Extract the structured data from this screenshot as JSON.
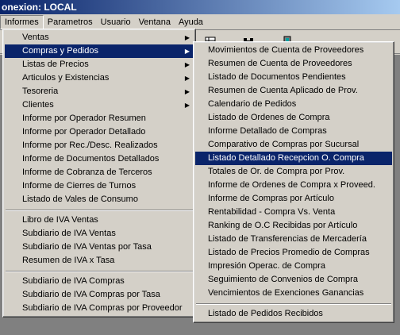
{
  "window": {
    "title": "onexion: LOCAL"
  },
  "menubar": {
    "items": [
      "Informes",
      "Parametros",
      "Usuario",
      "Ventana",
      "Ayuda"
    ]
  },
  "toolbar": {
    "icons": [
      "grid-icon",
      "binoculars-icon",
      "door-exit-icon"
    ]
  },
  "informes_menu": {
    "group1": [
      {
        "label": "Ventas",
        "submenu": true
      },
      {
        "label": "Compras y Pedidos",
        "submenu": true,
        "highlighted": true
      },
      {
        "label": "Listas de Precios",
        "submenu": true
      },
      {
        "label": "Articulos y Existencias",
        "submenu": true
      },
      {
        "label": "Tesoreria",
        "submenu": true
      },
      {
        "label": "Clientes",
        "submenu": true
      },
      {
        "label": "Informe por Operador Resumen"
      },
      {
        "label": "Informe por Operador Detallado"
      },
      {
        "label": "Informe por Rec./Desc. Realizados"
      },
      {
        "label": "Informe de Documentos Detallados"
      },
      {
        "label": "Informe de Cobranza de Terceros"
      },
      {
        "label": "Informe de Cierres de Turnos"
      },
      {
        "label": "Listado de Vales de Consumo"
      }
    ],
    "group2": [
      {
        "label": "Libro de IVA Ventas"
      },
      {
        "label": "Subdiario de IVA Ventas"
      },
      {
        "label": "Subdiario de IVA Ventas por Tasa"
      },
      {
        "label": "Resumen de IVA x Tasa"
      }
    ],
    "group3": [
      {
        "label": "Subdiario de IVA Compras"
      },
      {
        "label": "Subdiario de IVA Compras por Tasa"
      },
      {
        "label": "Subdiario de IVA Compras por Proveedor"
      }
    ]
  },
  "compras_menu": {
    "items": [
      {
        "label": "Movimientos de Cuenta de Proveedores"
      },
      {
        "label": "Resumen de Cuenta de Proveedores"
      },
      {
        "label": "Listado de Documentos Pendientes"
      },
      {
        "label": "Resumen de Cuenta Aplicado de Prov."
      },
      {
        "label": "Calendario de Pedidos"
      },
      {
        "label": "Listado de Ordenes de Compra"
      },
      {
        "label": "Informe Detallado de Compras"
      },
      {
        "label": "Comparativo de Compras por Sucursal"
      },
      {
        "label": "Listado Detallado Recepcion O. Compra",
        "highlighted": true
      },
      {
        "label": "Totales de Or. de Compra por Prov."
      },
      {
        "label": "Informe de Ordenes de Compra x Proveed."
      },
      {
        "label": "Informe de Compras por Artículo"
      },
      {
        "label": "Rentabilidad - Compra Vs. Venta"
      },
      {
        "label": "Ranking de O.C Recibidas por Artículo"
      },
      {
        "label": "Listado de Transferencias de Mercadería"
      },
      {
        "label": "Listado de Precios Promedio de Compras"
      },
      {
        "label": "Impresión Operac. de Compra"
      },
      {
        "label": "Seguimiento de Convenios de Compra"
      },
      {
        "label": "Vencimientos de Exenciones Ganancias"
      }
    ],
    "footer": [
      {
        "label": "Listado de Pedidos Recibidos"
      }
    ]
  }
}
